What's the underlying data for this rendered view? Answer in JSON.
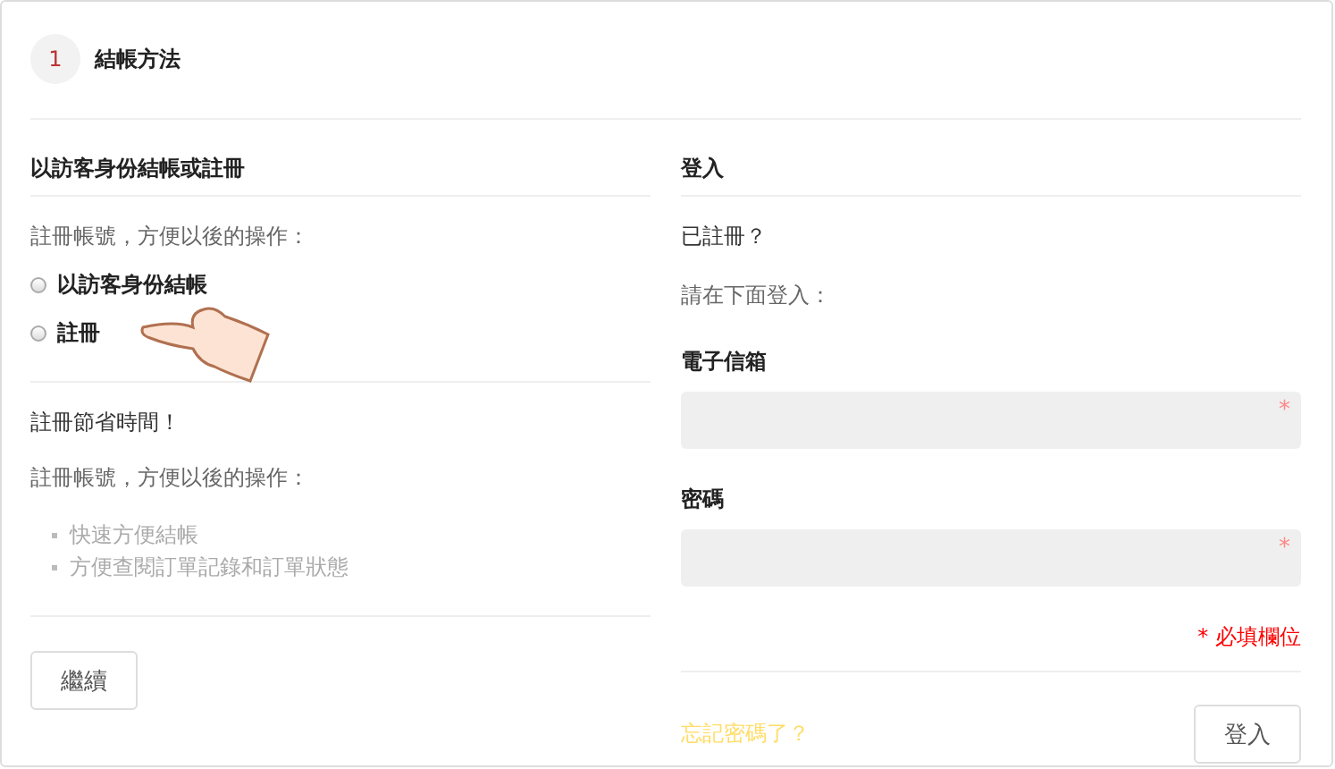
{
  "step": {
    "number": "1",
    "title": "結帳方法"
  },
  "guest": {
    "heading": "以訪客身份結帳或註冊",
    "intro": "註冊帳號，方便以後的操作：",
    "options": [
      {
        "label": "以訪客身份結帳",
        "selected": false
      },
      {
        "label": "註冊",
        "selected": false
      }
    ],
    "benefits_title": "註冊節省時間！",
    "benefits_intro": "註冊帳號，方便以後的操作：",
    "benefits": [
      "快速方便結帳",
      "方便查閱訂單記錄和訂單狀態"
    ],
    "continue_button": "繼續"
  },
  "login": {
    "heading": "登入",
    "registered": "已註冊？",
    "prompt": "請在下面登入：",
    "fields": [
      {
        "label": "電子信箱",
        "required_mark": "*"
      },
      {
        "label": "密碼",
        "required_mark": "*"
      }
    ],
    "required_note": "* 必填欄位",
    "forgot_link": "忘記密碼了？",
    "login_button": "登入"
  }
}
